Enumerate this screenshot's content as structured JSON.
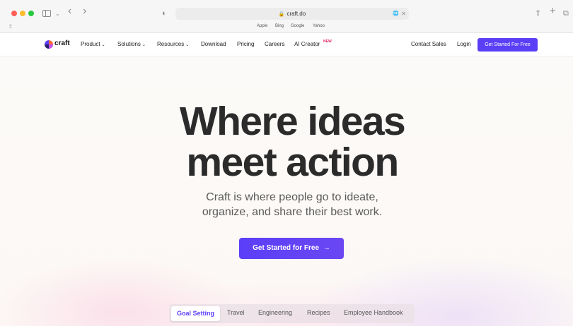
{
  "browser": {
    "url": "craft.do",
    "favorites": [
      "Apple",
      "Bing",
      "Google",
      "Yahoo"
    ]
  },
  "icons": {
    "lock": "🔒",
    "translate": "🌐",
    "close": "✕",
    "back": "‹",
    "forward": "›",
    "chevron": "⌄",
    "shield": "◐",
    "share": "⇧",
    "plus": "+",
    "tabs": "⧉",
    "grid": "⁞⁞⁞",
    "arrow": "→"
  },
  "colors": {
    "accent": "#5a3ff6",
    "new_badge": "#e0245e"
  },
  "nav": {
    "logo": "craft",
    "items": [
      "Product",
      "Solutions",
      "Resources",
      "Download",
      "Pricing",
      "Careers",
      "AI Creator"
    ],
    "new_badge": "NEW",
    "contact": "Contact Sales",
    "login": "Login",
    "cta": "Get Started For Free"
  },
  "hero": {
    "title_line1": "Where ideas",
    "title_line2": "meet action",
    "subtitle_line1": "Craft is where people go to ideate,",
    "subtitle_line2": "organize, and share their best work.",
    "cta": "Get Started for Free"
  },
  "tabs": {
    "items": [
      "Goal Setting",
      "Travel",
      "Engineering",
      "Recipes",
      "Employee Handbook"
    ],
    "active": "Goal Setting"
  }
}
